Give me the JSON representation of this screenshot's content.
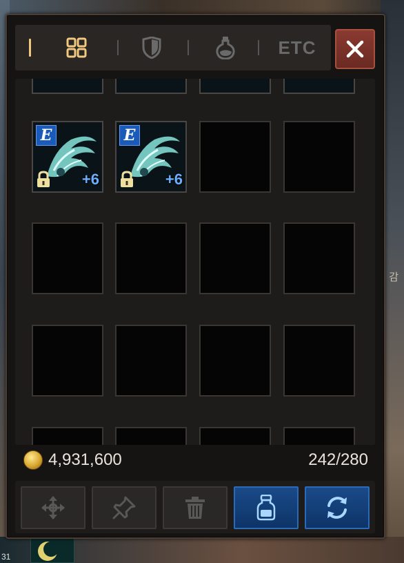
{
  "tabs": [
    {
      "id": "all",
      "icon": "grid-icon",
      "active": true
    },
    {
      "id": "equipment",
      "icon": "shield-icon"
    },
    {
      "id": "consumable",
      "icon": "potion-icon"
    },
    {
      "id": "etc",
      "label": "ETC"
    }
  ],
  "inventory": {
    "items": [
      {
        "grade_badge": "E",
        "enhancement": "+6",
        "locked": true,
        "icon": "accessory-icon"
      },
      {
        "grade_badge": "E",
        "enhancement": "+6",
        "locked": true,
        "icon": "accessory-icon"
      }
    ]
  },
  "footer": {
    "gold": "4,931,600",
    "capacity": "242/280"
  },
  "actions": [
    {
      "id": "move",
      "icon": "move-arrows-icon"
    },
    {
      "id": "pin",
      "icon": "pin-icon"
    },
    {
      "id": "delete",
      "icon": "trash-icon"
    },
    {
      "id": "potion",
      "icon": "potion-bottle-icon",
      "active": true
    },
    {
      "id": "sort",
      "icon": "refresh-icon",
      "active": true
    }
  ],
  "background": {
    "right_glyph": "감",
    "bottom_left_number": "31"
  },
  "colors": {
    "accent_gold": "#f0c880",
    "close_red": "#8a3a30",
    "active_blue": "#1a4a88",
    "enhance_blue": "#6ab0ff"
  }
}
